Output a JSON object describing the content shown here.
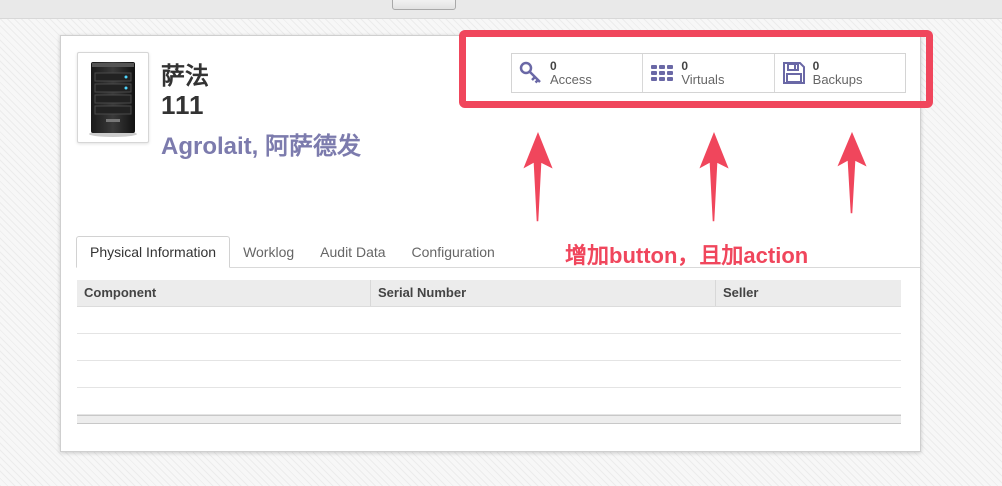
{
  "record": {
    "name": "萨法",
    "code": "111",
    "partner": "Agrolait, 阿萨德发"
  },
  "stat_buttons": [
    {
      "count": "0",
      "label": "Access",
      "icon": "key-icon"
    },
    {
      "count": "0",
      "label": "Virtuals",
      "icon": "grid-icon"
    },
    {
      "count": "0",
      "label": "Backups",
      "icon": "floppy-disk-icon"
    }
  ],
  "tabs": [
    {
      "label": "Physical Information",
      "active": true
    },
    {
      "label": "Worklog",
      "active": false
    },
    {
      "label": "Audit Data",
      "active": false
    },
    {
      "label": "Configuration",
      "active": false
    }
  ],
  "table": {
    "columns": [
      "Component",
      "Serial Number",
      "Seller"
    ]
  },
  "annotation": {
    "text": "增加button，且加action",
    "color": "#f0465c"
  },
  "colors": {
    "accent": "#7c7bad",
    "annotation": "#f0465c"
  }
}
